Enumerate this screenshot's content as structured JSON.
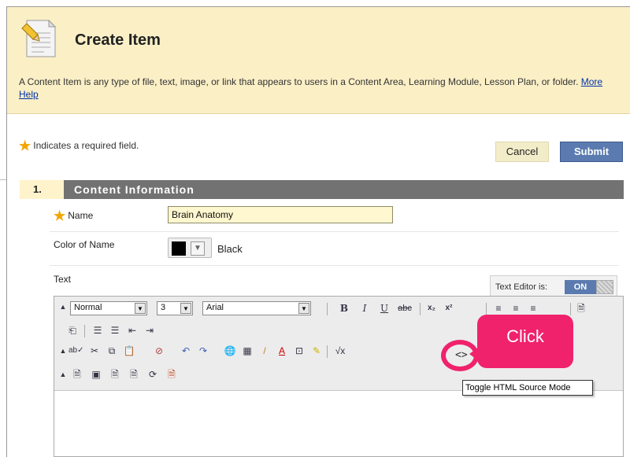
{
  "page": {
    "title": "Create Item",
    "description": "A Content Item is any type of file, text, image, or link that appears to users in a Content Area, Learning Module, Lesson Plan, or folder.",
    "help_link": "More Help",
    "required_note": "Indicates a required field."
  },
  "buttons": {
    "cancel": "Cancel",
    "submit": "Submit"
  },
  "section": {
    "number": "1.",
    "title": "Content Information"
  },
  "fields": {
    "name_label": "Name",
    "name_value": "Brain Anatomy",
    "color_label": "Color of Name",
    "color_value": "Black",
    "text_label": "Text"
  },
  "text_editor": {
    "label": "Text Editor is:",
    "state": "ON"
  },
  "toolbar": {
    "format": "Normal",
    "size": "3",
    "font": "Arial"
  },
  "tooltip": "Toggle HTML Source Mode",
  "callout": "Click",
  "colors": {
    "accent": "#f0226c",
    "header_bg": "#fbefc6",
    "submit_bg": "#5b7bb0",
    "section_bar": "#727272"
  }
}
